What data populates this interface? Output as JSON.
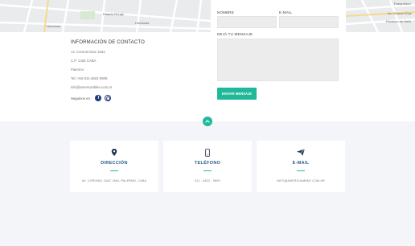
{
  "map": {
    "labels_left": [
      "Honduras",
      "Palacio Rouge",
      "Honduras"
    ],
    "labels_right": [
      "Av. Coronel Díaz",
      "Pacheco de Melo",
      "Pueyrredón"
    ]
  },
  "contact": {
    "title": "INFORMACIÓN DE CONTACTO",
    "address": "Av. Coronel Diaz 1564",
    "postal": "C.P. 1425 CABA",
    "district": "Palermo",
    "phone": "Tel.:+54-011-4822-0809",
    "email": "info@americanbike.com.ar",
    "social_label": "Seguinos en :",
    "facebook_letter": "f"
  },
  "form": {
    "name_label": "NOMBRE",
    "email_label": "E-MAIL",
    "message_label": "DEJÁ TU MENSAJE",
    "submit_label": "ENVIAR MENSAJE"
  },
  "cards": [
    {
      "icon": "map-pin-icon",
      "title": "DIRECCIÓN",
      "text": "AV. CORONEL DIAZ 1564, PALERMO, CABA"
    },
    {
      "icon": "phone-icon",
      "title": "TELÉFONO",
      "text": "011 - 4822 - 0809"
    },
    {
      "icon": "paper-plane-icon",
      "title": "E-MAIL",
      "text": "INFO@AMERICANBIKE.COM.AR"
    }
  ],
  "colors": {
    "accent": "#21b89a",
    "card_title": "#2c5e8c",
    "facebook": "#1e3c7b",
    "page_bg": "#f3f5f8"
  }
}
